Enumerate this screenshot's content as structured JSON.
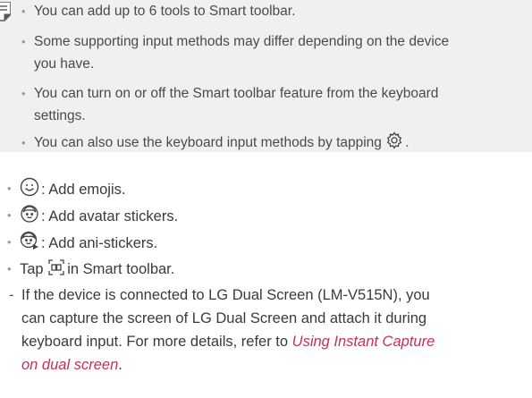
{
  "note": {
    "items": [
      {
        "lines": [
          "You can add up to 6 tools to Smart toolbar."
        ]
      },
      {
        "lines": [
          "Some supporting input methods may differ depending on the device",
          "you have."
        ]
      },
      {
        "lines": [
          "You can turn on or off the Smart toolbar feature from the keyboard",
          "settings."
        ]
      },
      {
        "lines": [
          "You can also use the keyboard input methods by tapping"
        ],
        "suffix": "."
      }
    ]
  },
  "main": {
    "items": [
      {
        "icon": "emoji-icon",
        "text": ": Add emojis."
      },
      {
        "icon": "avatar-sticker-icon",
        "text": ": Add avatar stickers."
      },
      {
        "icon": "ani-sticker-icon",
        "text": ": Add ani-stickers."
      },
      {
        "prefix": "Tap",
        "icon": "instant-capture-icon",
        "text": "in Smart toolbar."
      }
    ],
    "sub": {
      "lines": [
        "If the device is connected to LG Dual Screen (LM-V515N), you",
        "can capture the screen of LG Dual Screen and attach it during",
        "keyboard input. For more details, refer to"
      ],
      "link_part1": "Using Instant Capture",
      "link_part2": "on dual screen",
      "end": "."
    }
  },
  "colors": {
    "link": "#c2315a",
    "note_bg": "#f0f0f1",
    "text": "#3a3a3a"
  }
}
